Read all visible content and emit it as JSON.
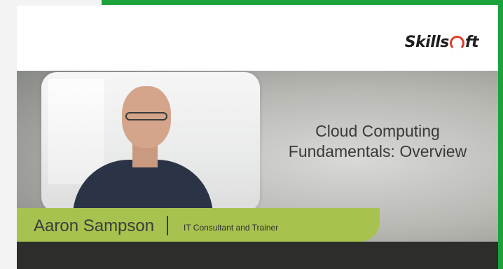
{
  "logo_text": {
    "pre": "Skills",
    "post": "ft"
  },
  "title": {
    "line1": "Cloud Computing",
    "line2": "Fundamentals: Overview"
  },
  "presenter": {
    "name": "Aaron Sampson",
    "role": "IT Consultant and Trainer"
  },
  "colors": {
    "accent_green": "#1aa33a",
    "bar_green": "#a8c24f",
    "dark": "#2d2e2b",
    "logo_red": "#e23a2a"
  }
}
